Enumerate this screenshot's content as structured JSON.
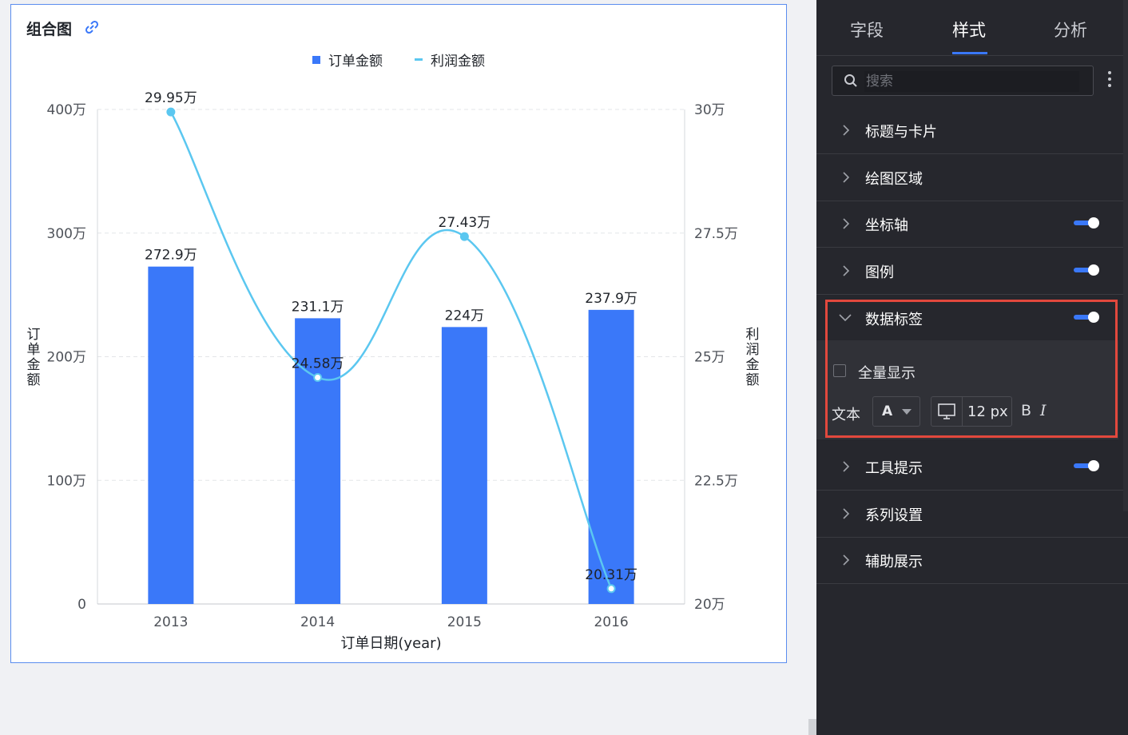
{
  "card": {
    "title": "组合图"
  },
  "chart_data": {
    "type": "bar+line",
    "title": "组合图",
    "categories": [
      "2013",
      "2014",
      "2015",
      "2016"
    ],
    "xlabel": "订单日期(year)",
    "ylabel_left": "订单金额",
    "ylabel_right": "利润金额",
    "left_axis": {
      "min": 0,
      "max": 4000000,
      "ticks": [
        "0",
        "100万",
        "200万",
        "300万",
        "400万"
      ]
    },
    "right_axis": {
      "min": 200000,
      "max": 300000,
      "ticks": [
        "20万",
        "22.5万",
        "25万",
        "27.5万",
        "30万"
      ]
    },
    "series": [
      {
        "name": "订单金额",
        "type": "bar",
        "axis": "left",
        "values": [
          2729000,
          2311000,
          2240000,
          2379000
        ],
        "labels": [
          "272.9万",
          "231.1万",
          "224万",
          "237.9万"
        ],
        "color": "#3a78f9"
      },
      {
        "name": "利润金额",
        "type": "line",
        "axis": "right",
        "values": [
          299500,
          245800,
          274300,
          203100
        ],
        "labels": [
          "29.95万",
          "24.58万",
          "27.43万",
          "20.31万"
        ],
        "color": "#5bc7f0"
      }
    ],
    "grid": true,
    "legend": "top-center"
  },
  "panel": {
    "tabs": [
      "字段",
      "样式",
      "分析"
    ],
    "active_tab": "样式",
    "search_placeholder": "搜索",
    "sections": [
      {
        "label": "标题与卡片",
        "toggle": false
      },
      {
        "label": "绘图区域",
        "toggle": false
      },
      {
        "label": "坐标轴",
        "toggle": true
      },
      {
        "label": "图例",
        "toggle": true
      },
      {
        "label": "数据标签",
        "toggle": true,
        "expanded": true
      },
      {
        "label": "工具提示",
        "toggle": true
      },
      {
        "label": "系列设置",
        "toggle": false
      },
      {
        "label": "辅助展示",
        "toggle": false
      }
    ],
    "data_label_options": {
      "show_all_label": "全量显示",
      "show_all_checked": false,
      "text_label": "文本",
      "font_color_glyph": "A",
      "font_size": "12 px",
      "bold_glyph": "B",
      "italic_glyph": "I"
    }
  },
  "colors": {
    "accent": "#3a78f9",
    "line": "#5bc7f0",
    "panel_bg": "#26272d",
    "highlight": "#e2483d"
  }
}
